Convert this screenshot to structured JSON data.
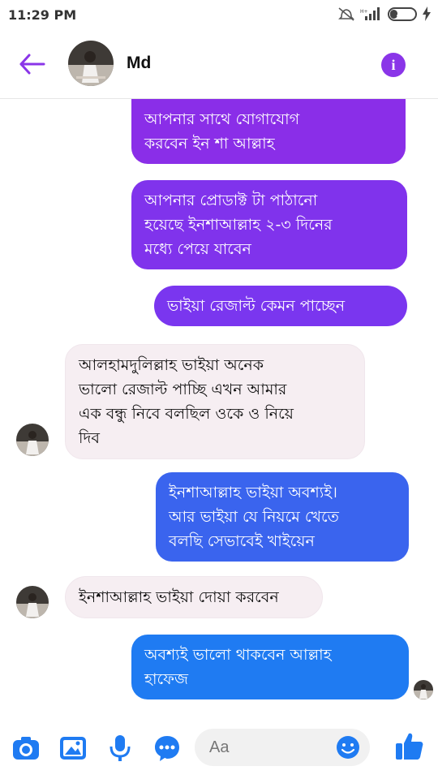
{
  "status_bar": {
    "time": "11:29 PM",
    "battery": "31",
    "battery_level": 0.31,
    "icons": [
      "mute-icon",
      "signal-icon",
      "battery-icon",
      "bolt-icon"
    ]
  },
  "header": {
    "contact_name": "Md",
    "back_icon": "arrow-left-icon",
    "info_icon": "info-icon",
    "info_glyph": "i",
    "accent": "#8a35e8"
  },
  "messages": [
    {
      "direction": "out",
      "text": "আপনার সাথে যোগাযোগ\nকরবেন ইন শা আল্লাহ"
    },
    {
      "direction": "out",
      "text": "আপনার প্রোডাক্ট টা পাঠানো\nহয়েছে ইনশাআল্লাহ ২-৩ দিনের\nমধ্যে পেয়ে যাবেন"
    },
    {
      "direction": "out",
      "text": "ভাইয়া রেজাল্ট কেমন পাচ্ছেন"
    },
    {
      "direction": "in",
      "text": "আলহামদুলিল্লাহ ভাইয়া অনেক\nভালো রেজাল্ট পাচ্ছি এখন আমার\nএক বন্ধু নিবে বলছিল  ওকে ও নিয়ে\nদিব"
    },
    {
      "direction": "out",
      "text": "ইনশাআল্লাহ ভাইয়া অবশ্যই।\nআর ভাইয়া যে নিয়মে খেতে\nবলছি  সেভাবেই  খাইয়েন"
    },
    {
      "direction": "in",
      "text": "ইনশাআল্লাহ ভাইয়া দোয়া করবেন"
    },
    {
      "direction": "out",
      "text": "অবশ্যই ভালো থাকবেন আল্লাহ\nহাফেজ"
    }
  ],
  "composer": {
    "placeholder": "Aa",
    "icons": [
      "camera-icon",
      "gallery-icon",
      "microphone-icon",
      "more-icon",
      "emoji-icon",
      "thumbs-up-icon"
    ],
    "icon_color": "#1f7bf2"
  },
  "colors": {
    "purple": "#8a2ee8",
    "violet": "#6a3ef0",
    "blue": "#3a64ee",
    "bright_blue": "#1f7bf2",
    "incoming_bg": "#f6eef2"
  }
}
